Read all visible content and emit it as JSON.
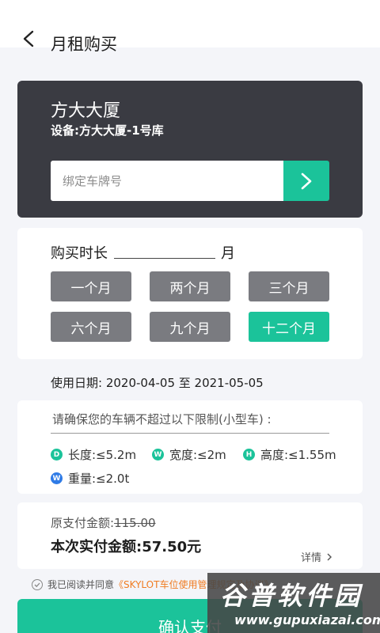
{
  "header": {
    "title": "月租购买",
    "back_icon": "chevron-left-icon"
  },
  "device": {
    "name": "方大大厦",
    "line": "设备:方大大厦-1号库",
    "plate_placeholder": "绑定车牌号",
    "go_icon": "chevron-right-icon",
    "accent_color": "#1bc39a"
  },
  "duration": {
    "label": "购买时长",
    "unit": "月",
    "options": [
      "一个月",
      "两个月",
      "三个月",
      "六个月",
      "九个月",
      "十二个月"
    ],
    "selected": "十二个月"
  },
  "usage_dates": "使用日期: 2020-04-05 至 2021-05-05",
  "limits": {
    "title": "请确保您的车辆不超过以下限制(小型车) :",
    "items": [
      {
        "badge": "D",
        "text": "长度:≤5.2m",
        "color": "#1bc39a"
      },
      {
        "badge": "W",
        "text": "宽度:≤2m",
        "color": "#1bc39a"
      },
      {
        "badge": "H",
        "text": "高度:≤1.55m",
        "color": "#1bc39a"
      },
      {
        "badge": "W",
        "text": "重量:≤2.0t",
        "color": "#2f7be6"
      }
    ]
  },
  "payment": {
    "original_label": "原支付金额:",
    "original_amount": "115.00",
    "actual": "本次实付金额:57.50元",
    "detail": "详情"
  },
  "agreement": {
    "prefix": "我已阅读并同意",
    "link": "《SKYLOT车位使用管理规定及协议》"
  },
  "confirm_label": "确认支付",
  "watermark": {
    "title": "谷普软件园",
    "url": "www.gupuxiazai.com"
  }
}
